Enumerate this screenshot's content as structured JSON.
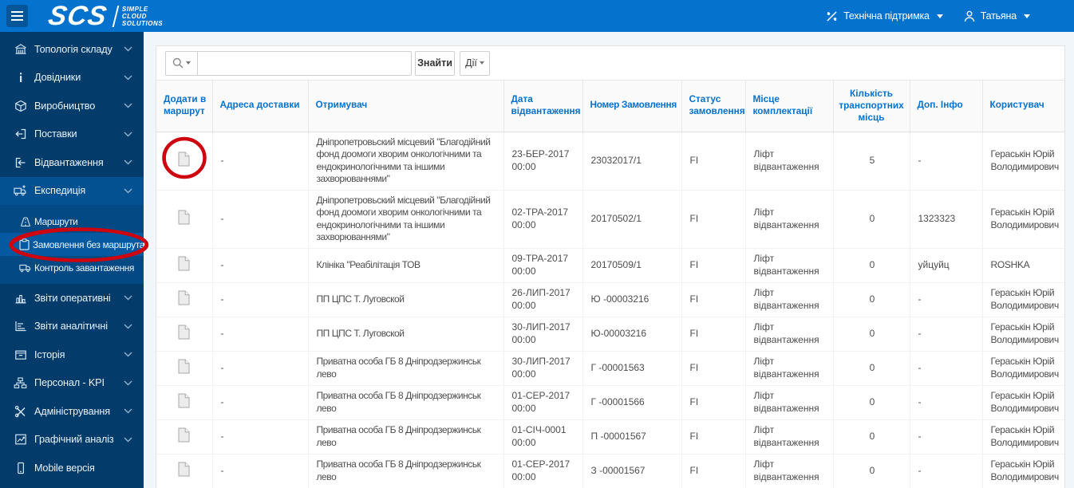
{
  "topbar": {
    "logo": "SCS",
    "logo_sub": [
      "SIMPLE",
      "CLOUD",
      "SOLUTIONS"
    ],
    "support_label": "Технічна підтримка",
    "user_name": "Татьяна"
  },
  "sidebar": {
    "items_top": [
      {
        "label": "Топологія складу",
        "icon": "warehouse-icon",
        "chevron": true
      },
      {
        "label": "Довідники",
        "icon": "info-icon",
        "chevron": true
      },
      {
        "label": "Виробництво",
        "icon": "production-icon",
        "chevron": true
      },
      {
        "label": "Поставки",
        "icon": "supply-icon",
        "chevron": true
      },
      {
        "label": "Відвантаження",
        "icon": "shipment-icon",
        "chevron": true
      },
      {
        "label": "Експедиція",
        "icon": "expedition-icon",
        "chevron": true,
        "active": true
      }
    ],
    "submenu": [
      {
        "label": "Маршрути",
        "icon": "routes-icon"
      },
      {
        "label": "Замовлення без маршрута",
        "icon": "orders-icon",
        "selected": true
      },
      {
        "label": "Контроль завантаження",
        "icon": "loading-icon"
      }
    ],
    "items_bottom": [
      {
        "label": "Звіти оперативні",
        "icon": "report-bars-icon",
        "chevron": true
      },
      {
        "label": "Звіти аналітичні",
        "icon": "report-lines-icon",
        "chevron": true
      },
      {
        "label": "Історія",
        "icon": "history-icon",
        "chevron": true
      },
      {
        "label": "Персонал - KPI",
        "icon": "staff-icon",
        "chevron": true
      },
      {
        "label": "Адміністрування",
        "icon": "admin-icon",
        "chevron": true
      },
      {
        "label": "Графічний аналіз",
        "icon": "graph-icon",
        "chevron": true
      },
      {
        "label": "Mobile версія",
        "icon": "mobile-icon",
        "chevron": false
      }
    ]
  },
  "search": {
    "input_value": "",
    "find_label": "Знайти",
    "actions_label": "Дії"
  },
  "table": {
    "columns": [
      "Додати в маршрут",
      "Адреса доставки",
      "Отримувач",
      "Дата відвантаження",
      "Номер Замовлення",
      "Статус замовлення",
      "Місце комплектації",
      "Кількість транспортних місць",
      "Доп. Інфо",
      "Користувач"
    ],
    "rows": [
      {
        "address": "-",
        "recipient": "Дніпропетровьский місцевий \"Благодійний фонд доомоги хворим онкологічними та ендокринологічними та іншими захворюваннями\"",
        "date": "23-БЕР-2017 00:00",
        "order": "23032017/1",
        "status": "FI",
        "place": "Ліфт відвантаження",
        "qty": "5",
        "info": "-",
        "user": "Гераськін Юрій Володимирович",
        "tall": true,
        "annotated": true
      },
      {
        "address": "-",
        "recipient": "Дніпропетровьский місцевий \"Благодійний фонд доомоги хворим онкологічними та ендокринологічними та іншими захворюваннями\"",
        "date": "02-ТРА-2017 00:00",
        "order": "20170502/1",
        "status": "FI",
        "place": "Ліфт відвантаження",
        "qty": "0",
        "info": "1323323",
        "user": "Гераськін Юрій Володимирович",
        "tall": true
      },
      {
        "address": "-",
        "recipient": "Клініка \"Реабілітація ТОВ",
        "date": "09-ТРА-2017 00:00",
        "order": "20170509/1",
        "status": "FI",
        "place": "Ліфт відвантаження",
        "qty": "0",
        "info": "уйцуйц",
        "user": "ROSHKA"
      },
      {
        "address": "-",
        "recipient": "ПП ЦПС Т. Луговской",
        "date": "26-ЛИП-2017 00:00",
        "order": "Ю -00003216",
        "status": "FI",
        "place": "Ліфт відвантаження",
        "qty": "0",
        "info": "-",
        "user": "Гераськін Юрій Володимирович"
      },
      {
        "address": "-",
        "recipient": "ПП ЦПС Т. Луговской",
        "date": "30-ЛИП-2017 00:00",
        "order": "Ю-00003216",
        "status": "FI",
        "place": "Ліфт відвантаження",
        "qty": "0",
        "info": "-",
        "user": "Гераськін Юрій Володимирович"
      },
      {
        "address": "-",
        "recipient": "Приватна особа ГБ 8 Дніпродзержинськ лево",
        "date": "30-ЛИП-2017 00:00",
        "order": "Г -00001563",
        "status": "FI",
        "place": "Ліфт відвантаження",
        "qty": "0",
        "info": "-",
        "user": "Гераськін Юрій Володимирович"
      },
      {
        "address": "-",
        "recipient": "Приватна особа ГБ 8 Дніпродзержинськ лево",
        "date": "01-СЕР-2017 00:00",
        "order": "Г -00001566",
        "status": "FI",
        "place": "Ліфт відвантаження",
        "qty": "0",
        "info": "-",
        "user": "Гераськін Юрій Володимирович"
      },
      {
        "address": "-",
        "recipient": "Приватна особа ГБ 8 Дніпродзержинськ лево",
        "date": "01-СІЧ-0001 00:00",
        "order": "П -00001567",
        "status": "FI",
        "place": "Ліфт відвантаження",
        "qty": "0",
        "info": "-",
        "user": "Гераськін Юрій Володимирович"
      },
      {
        "address": "-",
        "recipient": "Приватна особа ГБ 8 Дніпродзержинськ лево",
        "date": "01-СЕР-2017 00:00",
        "order": "З -00001567",
        "status": "FI",
        "place": "Ліфт відвантаження",
        "qty": "0",
        "info": "-",
        "user": "Гераськін Юрій Володимирович"
      }
    ]
  },
  "annotations": {
    "color": "#ce050e",
    "circled": [
      "sidebar-submenu-orders-without-route",
      "row-1-add-to-route-icon"
    ]
  }
}
